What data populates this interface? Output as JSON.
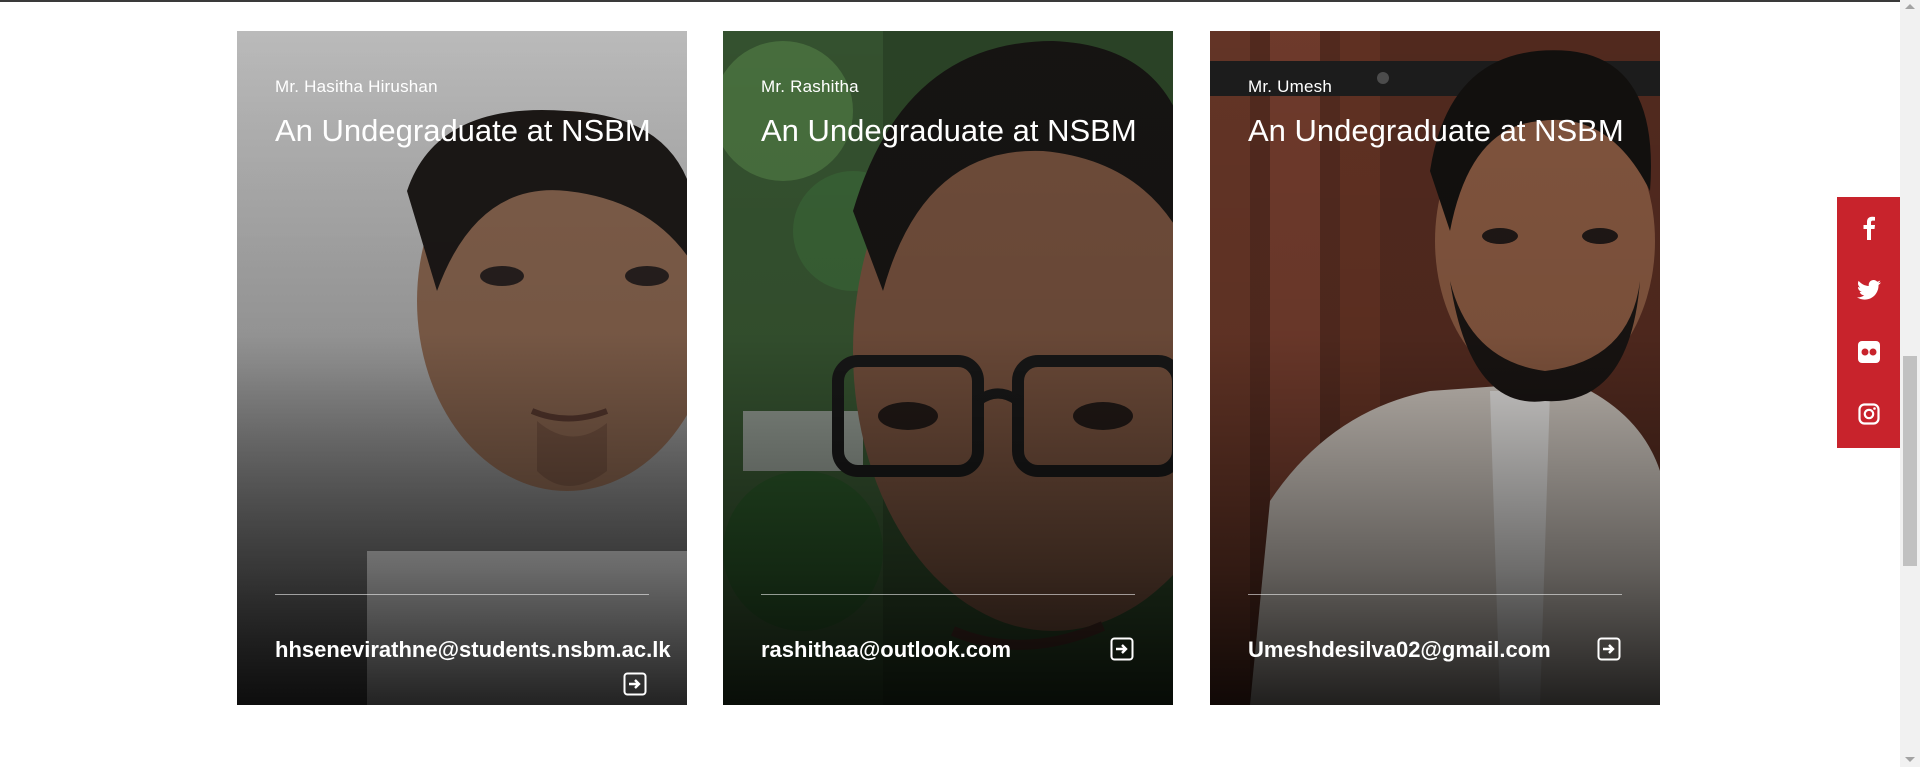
{
  "team": {
    "cards": [
      {
        "name": "Mr. Hasitha Hirushan",
        "role": "An Undegraduate at NSBM",
        "email": "hhsenevirathne@students.nsbm.ac.lk",
        "arrow_icon": "arrow-right-box-icon"
      },
      {
        "name": "Mr. Rashitha",
        "role": "An Undegraduate at NSBM",
        "email": "rashithaa@outlook.com",
        "arrow_icon": "arrow-right-box-icon"
      },
      {
        "name": "Mr. Umesh",
        "role": "An Undegraduate at NSBM",
        "email": "Umeshdesilva02@gmail.com",
        "arrow_icon": "arrow-right-box-icon"
      }
    ]
  },
  "social_bar": {
    "color": "#c8232c",
    "items": [
      "facebook-icon",
      "twitter-icon",
      "flickr-icon",
      "instagram-icon"
    ]
  }
}
